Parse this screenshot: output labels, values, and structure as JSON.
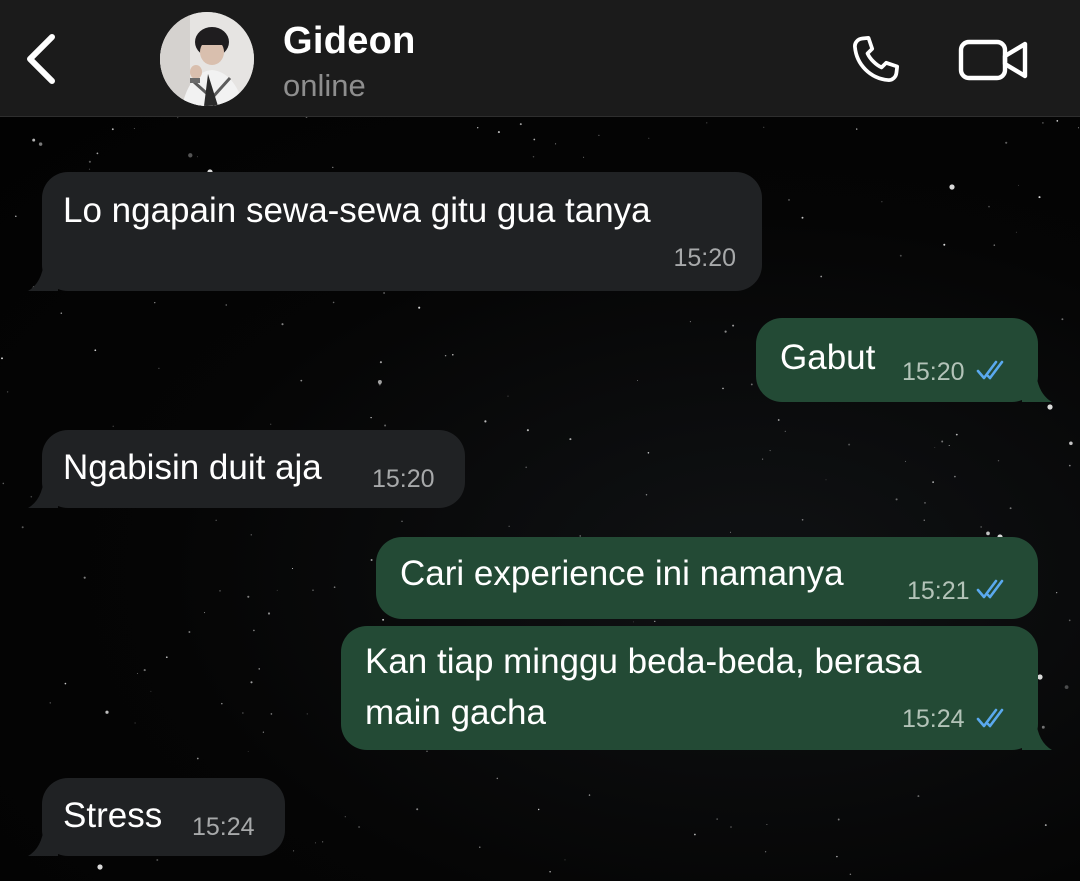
{
  "header": {
    "back_icon": "chevron-left-icon",
    "contact_name": "Gideon",
    "contact_status": "online",
    "call_icon": "phone-icon",
    "video_icon": "video-camera-icon"
  },
  "colors": {
    "header_bg": "#1b1b1b",
    "incoming_bubble": "#202224",
    "outgoing_bubble": "#234a35",
    "read_ticks": "#5aa9ee",
    "timestamp": "#a7a9aa"
  },
  "messages": [
    {
      "direction": "incoming",
      "text": "Lo ngapain sewa-sewa gitu gua tanya",
      "time": "15:20"
    },
    {
      "direction": "outgoing",
      "text": "Gabut",
      "time": "15:20",
      "status": "read"
    },
    {
      "direction": "incoming",
      "text": "Ngabisin duit aja",
      "time": "15:20"
    },
    {
      "direction": "outgoing",
      "text": "Cari experience ini namanya",
      "time": "15:21",
      "status": "read"
    },
    {
      "direction": "outgoing",
      "text_line1": "Kan tiap minggu beda-beda, berasa",
      "text_line2": "main gacha",
      "time": "15:24",
      "status": "read"
    },
    {
      "direction": "incoming",
      "text": "Stress",
      "time": "15:24"
    }
  ]
}
